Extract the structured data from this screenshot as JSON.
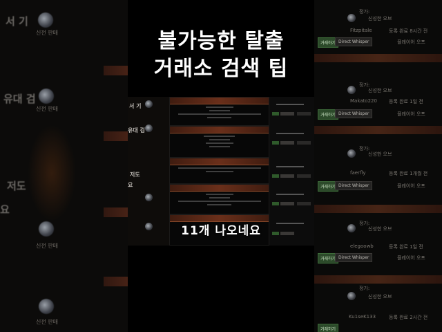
{
  "title": {
    "line1": "불가능한 탈출",
    "line2": "거래소 검색 팁"
  },
  "overlay_caption": "11개 나오네요",
  "left_background": {
    "texts": [
      "서 기",
      "유대 검",
      "저도",
      "요"
    ],
    "tag": "신전 판매"
  },
  "right_background": {
    "price_label": "정가:",
    "price_item": "신성한 오브",
    "rows": [
      {
        "user": "Fitzpitale",
        "time": "등록 완료 8시간 전"
      },
      {
        "user": "Makato220",
        "time": "등록 완료 1일 전"
      },
      {
        "user": "faerfly",
        "time": "등록 완료 1개월 전"
      },
      {
        "user": "elegoowb",
        "time": "등록 완료 1일 전"
      },
      {
        "user": "Ku1seK133",
        "time": "등록 완료 2시간 전"
      }
    ],
    "trade_label": "거래하기",
    "whisper_label": "Direct Whisper",
    "offline_label": "플레이어 오프"
  },
  "shot": {
    "left_texts": [
      "서 기",
      "유대 검",
      "저도",
      "요"
    ]
  }
}
